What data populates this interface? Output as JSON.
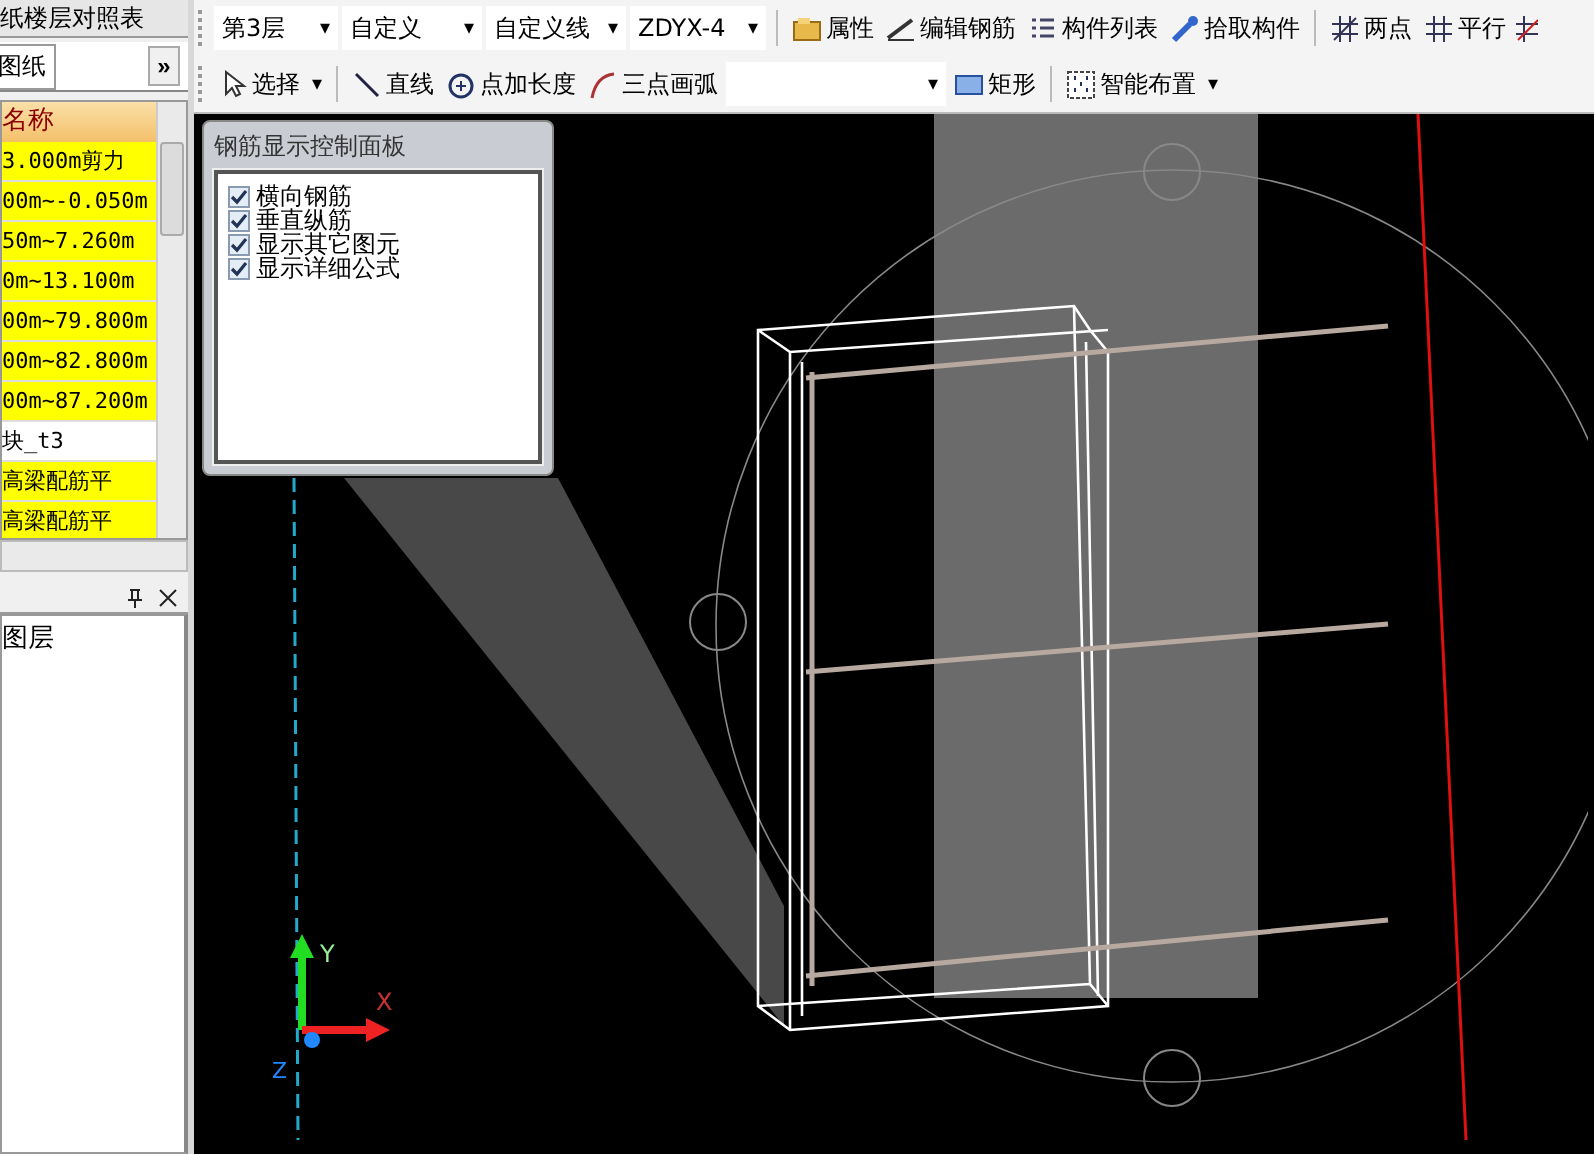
{
  "left_panel": {
    "title_tab": "纸楼层对照表",
    "tab": "图纸",
    "more": "»",
    "table": {
      "header": "名称",
      "rows": [
        {
          "text": "3.000m剪力",
          "highlighted": true
        },
        {
          "text": "00m~-0.050m",
          "highlighted": true
        },
        {
          "text": "50m~7.260m",
          "highlighted": true
        },
        {
          "text": "0m~13.100m",
          "highlighted": true
        },
        {
          "text": "00m~79.800m",
          "highlighted": true
        },
        {
          "text": "00m~82.800m",
          "highlighted": true
        },
        {
          "text": "00m~87.200m",
          "highlighted": true
        },
        {
          "text": "块_t3",
          "highlighted": false
        },
        {
          "text": "高梁配筋平",
          "highlighted": true
        },
        {
          "text": "高梁配筋平",
          "highlighted": true
        }
      ]
    }
  },
  "layer_panel": {
    "items": [
      "图层"
    ]
  },
  "toolbar_row1": [
    {
      "kind": "dropdown",
      "label": "第3层",
      "caret": "▾"
    },
    {
      "kind": "dropdown",
      "label": "自定义",
      "caret": "▾"
    },
    {
      "kind": "dropdown",
      "label": "自定义线",
      "caret": "▾"
    },
    {
      "kind": "dropdown",
      "label": "ZDYX-4",
      "caret": "▾"
    },
    {
      "kind": "button",
      "label": "属性"
    },
    {
      "kind": "button",
      "label": "编辑钢筋"
    },
    {
      "kind": "button",
      "label": "构件列表"
    },
    {
      "kind": "button",
      "label": "拾取构件"
    },
    {
      "kind": "button",
      "label": "两点"
    },
    {
      "kind": "button",
      "label": "平行"
    }
  ],
  "toolbar_row2": [
    {
      "kind": "menu",
      "label": "选择",
      "caret": "▾"
    },
    {
      "kind": "button",
      "label": "直线"
    },
    {
      "kind": "button",
      "label": "点加长度"
    },
    {
      "kind": "button",
      "label": "三点画弧"
    },
    {
      "kind": "dropdown",
      "caret": "▾"
    },
    {
      "kind": "button",
      "label": "矩形"
    },
    {
      "kind": "menu",
      "label": "智能布置",
      "caret": "▾"
    }
  ],
  "control_panel": {
    "title": "钢筋显示控制面板",
    "options": [
      {
        "label": "横向钢筋",
        "checked": true
      },
      {
        "label": "垂直纵筋",
        "checked": true
      },
      {
        "label": "显示其它图元",
        "checked": true
      },
      {
        "label": "显示详细公式",
        "checked": true
      }
    ]
  },
  "axis_labels": {
    "y": "Y",
    "x": "X",
    "z": "Z"
  }
}
